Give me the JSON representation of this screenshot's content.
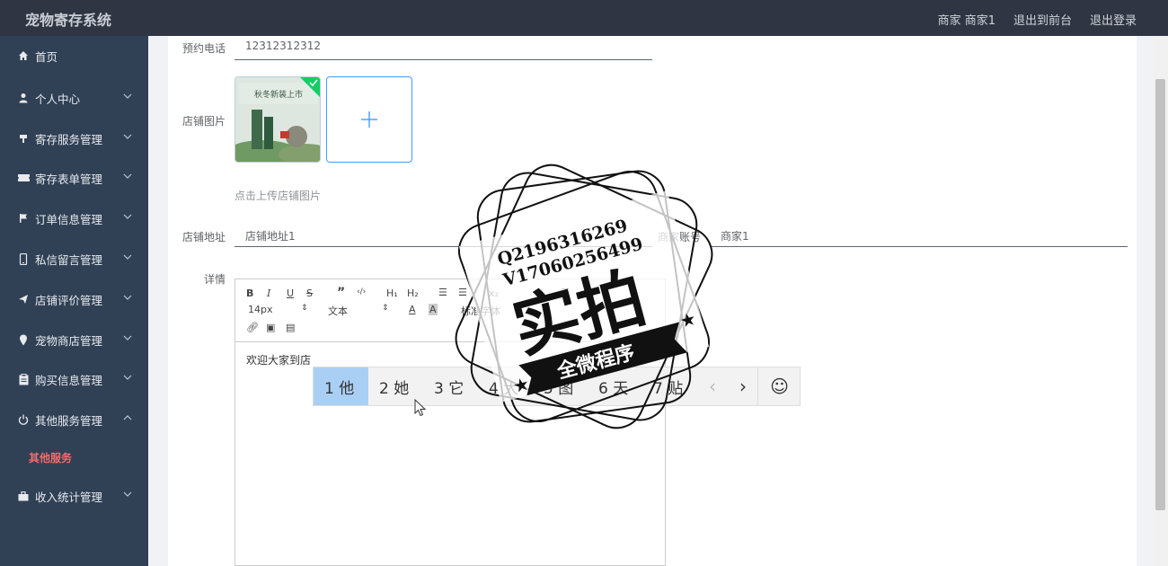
{
  "app": {
    "title": "宠物寄存系统",
    "links": [
      "商家 商家1",
      "退出到前台",
      "退出登录"
    ]
  },
  "sidebar": {
    "items": [
      {
        "label": "首页",
        "icon": "home-icon"
      },
      {
        "label": "个人中心",
        "icon": "user-icon"
      },
      {
        "label": "寄存服务管理",
        "icon": "flag-icon"
      },
      {
        "label": "寄存表单管理",
        "icon": "ticket-icon"
      },
      {
        "label": "订单信息管理",
        "icon": "flag-icon"
      },
      {
        "label": "私信留言管理",
        "icon": "phone-icon"
      },
      {
        "label": "店铺评价管理",
        "icon": "send-icon"
      },
      {
        "label": "宠物商店管理",
        "icon": "location-icon"
      },
      {
        "label": "购买信息管理",
        "icon": "clipboard-icon"
      },
      {
        "label": "其他服务管理",
        "icon": "power-icon"
      },
      {
        "label": "收入统计管理",
        "icon": "briefcase-icon"
      }
    ],
    "active_sub": "其他服务"
  },
  "form": {
    "phone_label": "预约电话",
    "phone_value": "12312312312",
    "image_label": "店铺图片",
    "image_thumb_text": "秋冬新装上市",
    "upload_hint": "点击上传店铺图片",
    "address_label": "店铺地址",
    "address_value": "店铺地址1",
    "account_label": "商家账号",
    "account_value": "商家1",
    "detail_label": "详情"
  },
  "editor": {
    "font_size": "14px",
    "block_type": "文本",
    "font_family": "标准字体",
    "content": "欢迎大家到店"
  },
  "ime": {
    "candidates": [
      "1 他",
      "2 她",
      "3 它",
      "4 大",
      "5 图",
      "6 天",
      "7 贴"
    ],
    "prev": "‹",
    "next": "›",
    "emoji": "☺"
  },
  "watermark": {
    "line1": "Q2196316269",
    "line2": "V17060256499",
    "main": "实拍",
    "ribbon": "全微程序"
  },
  "colors": {
    "topbar": "#2f3542",
    "sidebar": "#304156",
    "active_sub": "#f56c6c",
    "accent": "#409eff"
  }
}
